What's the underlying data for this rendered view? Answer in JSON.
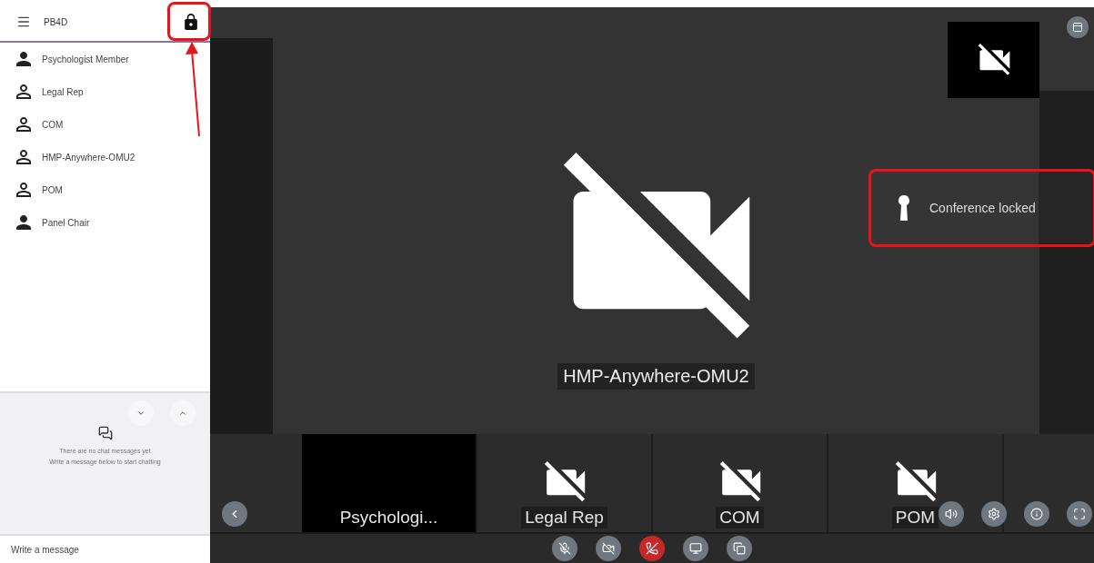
{
  "sidebar": {
    "conference_name": "PB4D",
    "locked": true,
    "participants": [
      {
        "name": "Psychologist Member",
        "kind": "filled"
      },
      {
        "name": "Legal Rep",
        "kind": "outline"
      },
      {
        "name": "COM",
        "kind": "outline"
      },
      {
        "name": "HMP-Anywhere-OMU2",
        "kind": "outline"
      },
      {
        "name": "POM",
        "kind": "outline"
      },
      {
        "name": "Panel Chair",
        "kind": "filled"
      }
    ],
    "chat": {
      "empty_title": "There are no chat messages yet",
      "empty_hint": "Write a message below to start chatting",
      "input": {
        "placeholder": "Write a message"
      }
    }
  },
  "stage": {
    "main_speaker": {
      "name": "HMP-Anywhere-OMU2",
      "camera_off": true
    },
    "self_view": {
      "camera_off": true
    },
    "toast": {
      "text": "Conference locked"
    },
    "thumbnails": [
      {
        "name": "Psychologi...",
        "camera_off": false
      },
      {
        "name": "Legal Rep",
        "camera_off": true
      },
      {
        "name": "COM",
        "camera_off": true
      },
      {
        "name": "POM",
        "camera_off": true
      }
    ]
  }
}
